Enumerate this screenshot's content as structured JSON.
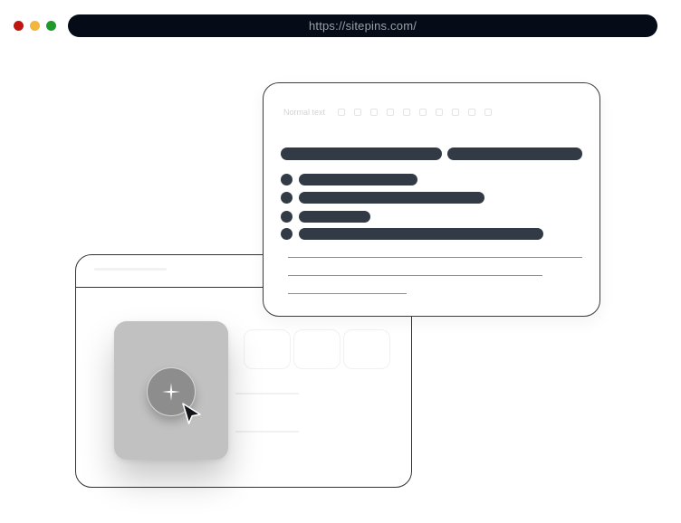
{
  "browser": {
    "url": "https://sitepins.com/",
    "controls": [
      {
        "name": "close",
        "color": "#c0160f"
      },
      {
        "name": "minimize",
        "color": "#f2b63a"
      },
      {
        "name": "maximize",
        "color": "#1f9a2a"
      }
    ],
    "urlbar_color": "#050c17"
  },
  "editor": {
    "style_selector": "Normal text",
    "text_color": "#323b45"
  },
  "add_card": {
    "icon": "plus-sparkle-icon",
    "card_color": "#c1c1c1",
    "button_color": "#8d8d8d"
  }
}
